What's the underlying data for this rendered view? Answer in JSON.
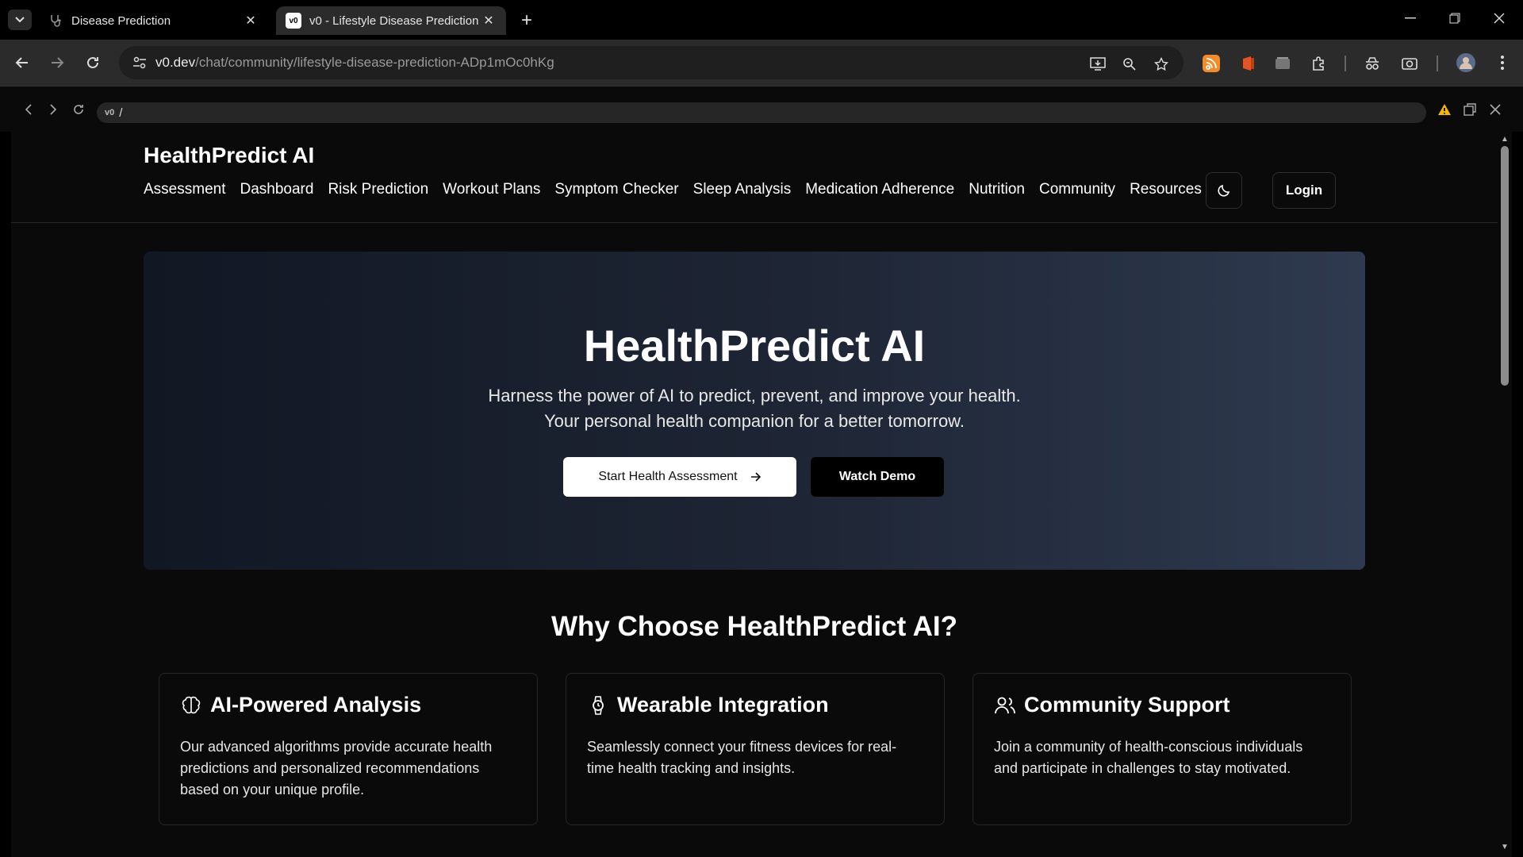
{
  "browser": {
    "tabs": [
      {
        "title": "Disease Prediction",
        "active": false
      },
      {
        "title": "v0 - Lifestyle Disease Prediction",
        "active": true
      }
    ],
    "address": {
      "host": "v0.dev",
      "path": "/chat/community/lifestyle-disease-prediction-ADp1mOc0hKg"
    }
  },
  "preview": {
    "logo": "v0",
    "path": "/"
  },
  "site": {
    "brand": "HealthPredict AI",
    "nav": [
      "Assessment",
      "Dashboard",
      "Risk Prediction",
      "Workout Plans",
      "Symptom Checker",
      "Sleep Analysis",
      "Medication Adherence",
      "Nutrition",
      "Community",
      "Resources"
    ],
    "login_label": "Login"
  },
  "hero": {
    "title": "HealthPredict AI",
    "subtitle_line1": "Harness the power of AI to predict, prevent, and improve your health.",
    "subtitle_line2": "Your personal health companion for a better tomorrow.",
    "primary_cta": "Start Health Assessment",
    "secondary_cta": "Watch Demo"
  },
  "features": {
    "title": "Why Choose HealthPredict AI?",
    "cards": [
      {
        "icon": "brain-icon",
        "title": "AI-Powered Analysis",
        "text": "Our advanced algorithms provide accurate health predictions and personalized recommendations based on your unique profile."
      },
      {
        "icon": "watch-icon",
        "title": "Wearable Integration",
        "text": "Seamlessly connect your fitness devices for real-time health tracking and insights."
      },
      {
        "icon": "users-icon",
        "title": "Community Support",
        "text": "Join a community of health-conscious individuals and participate in challenges to stay motivated."
      }
    ]
  }
}
